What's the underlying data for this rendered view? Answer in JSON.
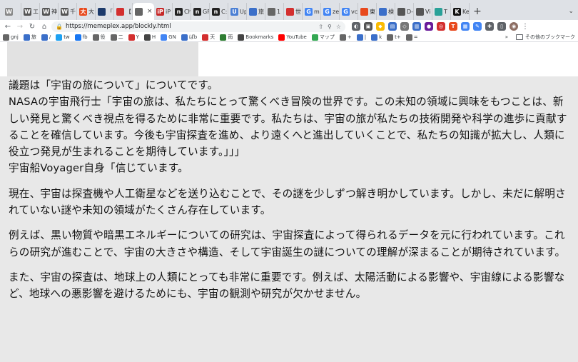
{
  "browser": {
    "tabs": [
      {
        "fav": "W",
        "color": "#888888",
        "label": ""
      },
      {
        "fav": "W",
        "color": "#555555",
        "label": "エ"
      },
      {
        "fav": "W",
        "color": "#555555",
        "label": "神"
      },
      {
        "fav": "W",
        "color": "#555555",
        "label": "千"
      },
      {
        "fav": "大",
        "color": "#e8491d",
        "label": "大"
      },
      {
        "fav": "",
        "color": "#1d3a6b",
        "label": "「"
      },
      {
        "fav": "",
        "color": "#d32f2f",
        "label": "【"
      },
      {
        "fav": "",
        "color": "#666666",
        "label": "",
        "active": true
      },
      {
        "fav": "iP",
        "color": "#c62828",
        "label": "iP"
      },
      {
        "fav": "n",
        "color": "#222222",
        "label": "Ch"
      },
      {
        "fav": "n",
        "color": "#222222",
        "label": "GF"
      },
      {
        "fav": "n",
        "color": "#222222",
        "label": "C:"
      },
      {
        "fav": "U",
        "color": "#4a7fd4",
        "label": "Up"
      },
      {
        "fav": "",
        "color": "#3b6fc9",
        "label": "旅"
      },
      {
        "fav": "",
        "color": "#666666",
        "label": "1"
      },
      {
        "fav": "",
        "color": "#d32f2f",
        "label": "世"
      },
      {
        "fav": "G",
        "color": "#4285f4",
        "label": "m"
      },
      {
        "fav": "G",
        "color": "#4285f4",
        "label": "ze"
      },
      {
        "fav": "G",
        "color": "#4285f4",
        "label": "vc"
      },
      {
        "fav": "",
        "color": "#e8491d",
        "label": "東"
      },
      {
        "fav": "",
        "color": "#3b6fc9",
        "label": "検"
      },
      {
        "fav": "",
        "color": "#555555",
        "label": "D-"
      },
      {
        "fav": "",
        "color": "#555555",
        "label": "Vi"
      },
      {
        "fav": "",
        "color": "#2aa198",
        "label": "T"
      },
      {
        "fav": "K",
        "color": "#111111",
        "label": "Ke"
      }
    ],
    "url": "https://memeplex.app/blockly.html",
    "bookmarks": [
      {
        "label": "gnj",
        "color": "#666666"
      },
      {
        "label": "旅",
        "color": "#3b6fc9"
      },
      {
        "label": "/",
        "color": "#3b6fc9"
      },
      {
        "label": "tw",
        "color": "#1da1f2"
      },
      {
        "label": "fb",
        "color": "#1877f2"
      },
      {
        "label": "役",
        "color": "#666666"
      },
      {
        "label": "二",
        "color": "#666666"
      },
      {
        "label": "Y",
        "color": "#d32f2f"
      },
      {
        "label": "H",
        "color": "#444444"
      },
      {
        "label": "GN",
        "color": "#4285f4"
      },
      {
        "label": "ぱb",
        "color": "#3b6fc9"
      },
      {
        "label": "天",
        "color": "#d32f2f"
      },
      {
        "label": "雨",
        "color": "#2e7d32"
      },
      {
        "label": "Bookmarks",
        "color": "#444444"
      },
      {
        "label": "YouTube",
        "color": "#ff0000"
      },
      {
        "label": "マップ",
        "color": "#34a853"
      },
      {
        "label": "+",
        "color": "#666666"
      },
      {
        "label": "|",
        "color": "#3b6fc9"
      },
      {
        "label": "k",
        "color": "#3b6fc9"
      },
      {
        "label": "t+",
        "color": "#666666"
      },
      {
        "label": "=",
        "color": "#666666"
      }
    ],
    "other_bookmarks": "その他のブックマーク"
  },
  "article": {
    "p1_line1": "議題は「宇宙の旅について」についてです。",
    "p1_line2": "NASAの宇宙飛行士「宇宙の旅は、私たちにとって驚くべき冒険の世界です。この未知の領域に興味をもつことは、新しい発見と驚くべき視点を得るために非常に重要です。私たちは、宇宙の旅が私たちの技術開発や科学の進歩に貢献することを確信しています。今後も宇宙探査を進め、より遠くへと進出していくことで、私たちの知識が拡大し、人類に役立つ発見が生まれることを期待しています。」」」",
    "p1_line3": "宇宙船Voyager自身「信じています。",
    "p2": "現在、宇宙は探査機や人工衛星などを送り込むことで、その謎を少しずつ解き明かしています。しかし、未だに解明されていない謎や未知の領域がたくさん存在しています。",
    "p3": "例えば、黒い物質や暗黒エネルギーについての研究は、宇宙探査によって得られるデータを元に行われています。これらの研究が進むことで、宇宙の大きさや構造、そして宇宙誕生の謎についての理解が深まることが期待されています。",
    "p4": "また、宇宙の探査は、地球上の人類にとっても非常に重要です。例えば、太陽活動による影響や、宇宙線による影響など、地球への悪影響を避けるためにも、宇宙の観測や研究が欠かせません。"
  }
}
